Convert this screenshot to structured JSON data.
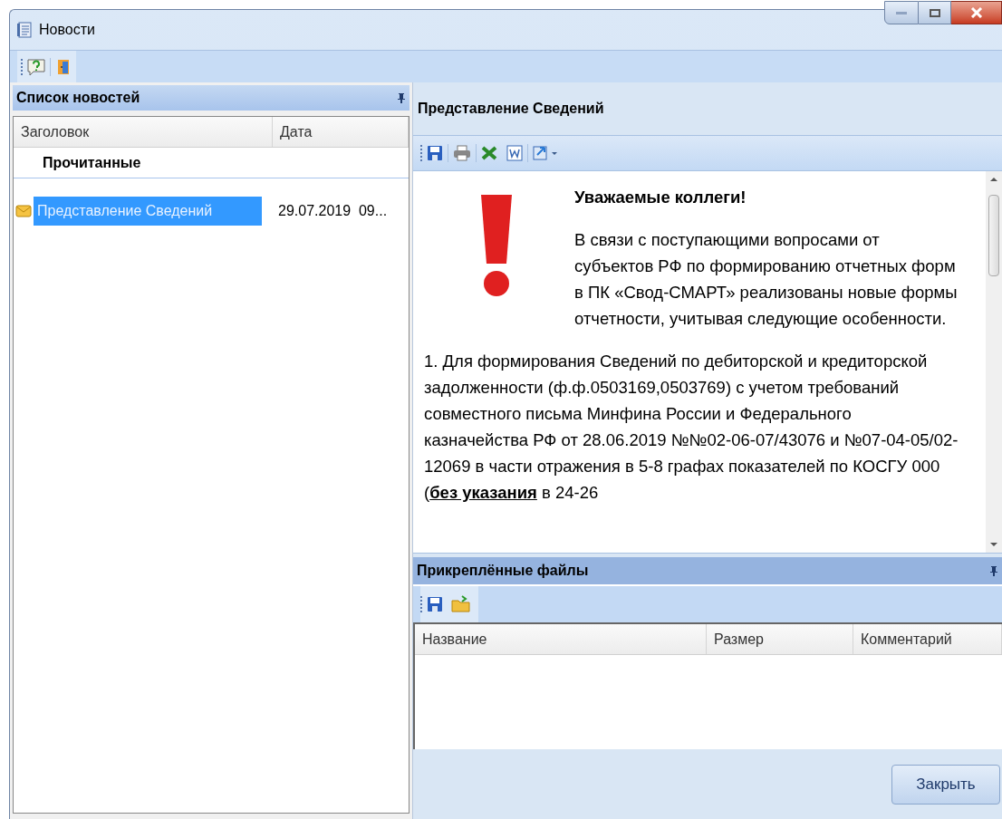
{
  "window": {
    "title": "Новости"
  },
  "news_list": {
    "title": "Список новостей",
    "columns": [
      "Заголовок",
      "Дата"
    ],
    "groups": [
      {
        "label": "Прочитанные",
        "items": [
          {
            "title": "Представление Сведений",
            "date": "29.07.2019  09...",
            "selected": true
          }
        ]
      }
    ]
  },
  "document": {
    "title": "Представление Сведений",
    "heading": "Уважаемые коллеги!",
    "paragraphs": [
      "В связи с поступающими вопросами от субъектов РФ по формированию отчетных форм в ПК «Свод-СМАРТ» реализованы новые формы отчетности, учитывая следующие особенности.",
      "1. Для формирования Сведений по дебиторской и кредиторской задолженности (ф.ф.0503169,0503769) с учетом требований совместного письма Минфина России и Федерального казначейства РФ от 28.06.2019 №№02-06-07/43076 и №07-04-05/02-12069 в части отражения в 5-8 графах показателей по КОСГУ 000 (**без указания** в 24-26"
    ]
  },
  "attachments": {
    "title": "Прикреплённые файлы",
    "columns": [
      "Название",
      "Размер",
      "Комментарий"
    ]
  },
  "buttons": [
    "Закрыть"
  ]
}
